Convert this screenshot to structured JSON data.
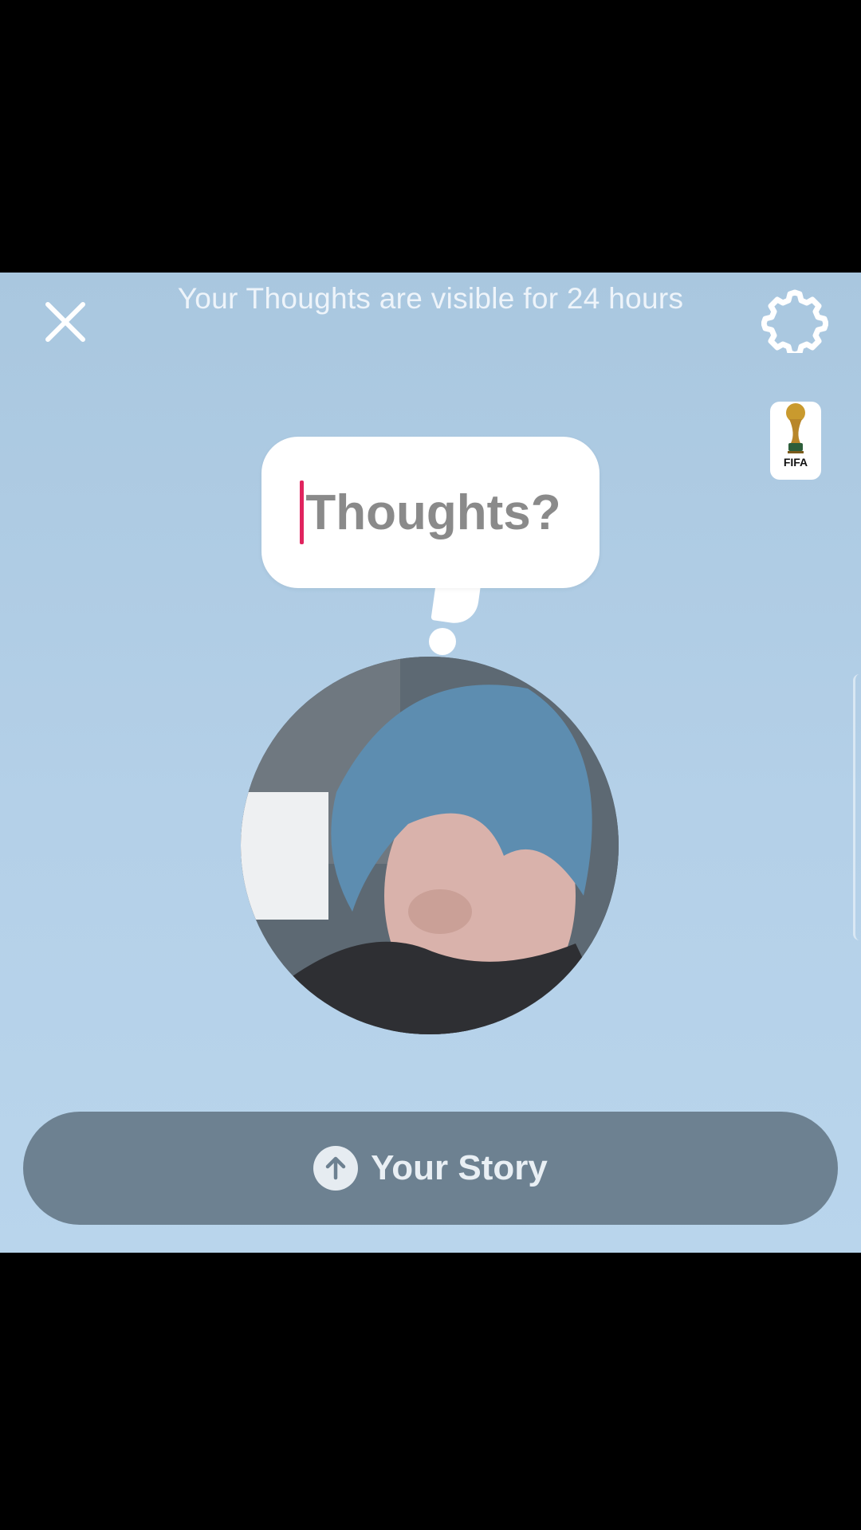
{
  "header": {
    "info_text": "Your Thoughts are visible for 24 hours",
    "close_icon": "close-icon",
    "settings_icon": "gear-icon"
  },
  "sticker": {
    "label": "FIFA",
    "icon": "world-cup-trophy-icon"
  },
  "thought": {
    "placeholder": "Thoughts?",
    "caret_color": "#e0245e"
  },
  "avatar": {
    "icon": "profile-photo"
  },
  "story_button": {
    "label": "Your Story",
    "icon": "upload-arrow-icon"
  },
  "colors": {
    "background": "#b4d0e8",
    "button": "#6d8191"
  }
}
